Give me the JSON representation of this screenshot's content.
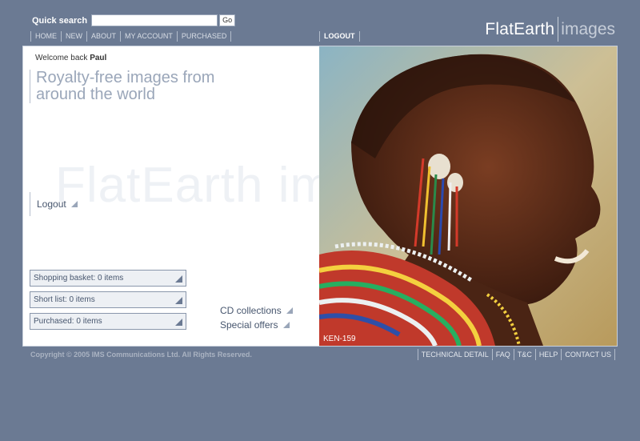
{
  "search": {
    "label": "Quick search",
    "placeholder": "",
    "value": "",
    "go_label": "Go"
  },
  "nav": {
    "items": [
      "HOME",
      "NEW",
      "ABOUT",
      "MY ACCOUNT",
      "PURCHASED"
    ],
    "logout": "LOGOUT"
  },
  "logo": {
    "part1": "FlatEarth",
    "part2": "images"
  },
  "main": {
    "welcome_prefix": "Welcome back",
    "welcome_name": "Paul",
    "tagline": "Royalty-free images from around the world",
    "watermark": "FlatEarth images",
    "logout": "Logout",
    "boxes": [
      "Shopping basket: 0 items",
      "Short list: 0 items",
      "Purchased: 0 items"
    ],
    "links": [
      "CD collections",
      "Special offers"
    ],
    "photo_code": "KEN-159"
  },
  "footer": {
    "copyright": "Copyright © 2005 IMS Communications Ltd. All Rights Reserved.",
    "links": [
      "TECHNICAL DETAIL",
      "FAQ",
      "T&C",
      "HELP",
      "CONTACT US"
    ]
  }
}
